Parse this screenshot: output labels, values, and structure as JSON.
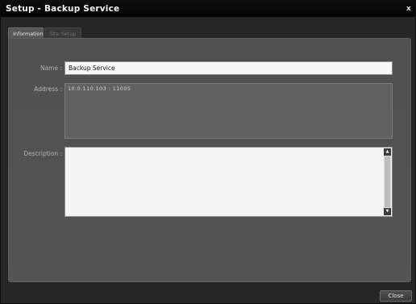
{
  "window": {
    "title": "Setup - Backup Service",
    "close_glyph": "x"
  },
  "tabs": [
    {
      "label": "Information",
      "active": true
    },
    {
      "label": "Site Setup",
      "active": false
    }
  ],
  "form": {
    "name_label": "Name :",
    "name_value": "Backup Service",
    "address_label": "Address :",
    "address_value": "10.0.110.103 : 11005",
    "description_label": "Description :",
    "description_value": ""
  },
  "scrollbar": {
    "up_glyph": "▲",
    "down_glyph": "▼"
  },
  "footer": {
    "close_label": "Close"
  }
}
